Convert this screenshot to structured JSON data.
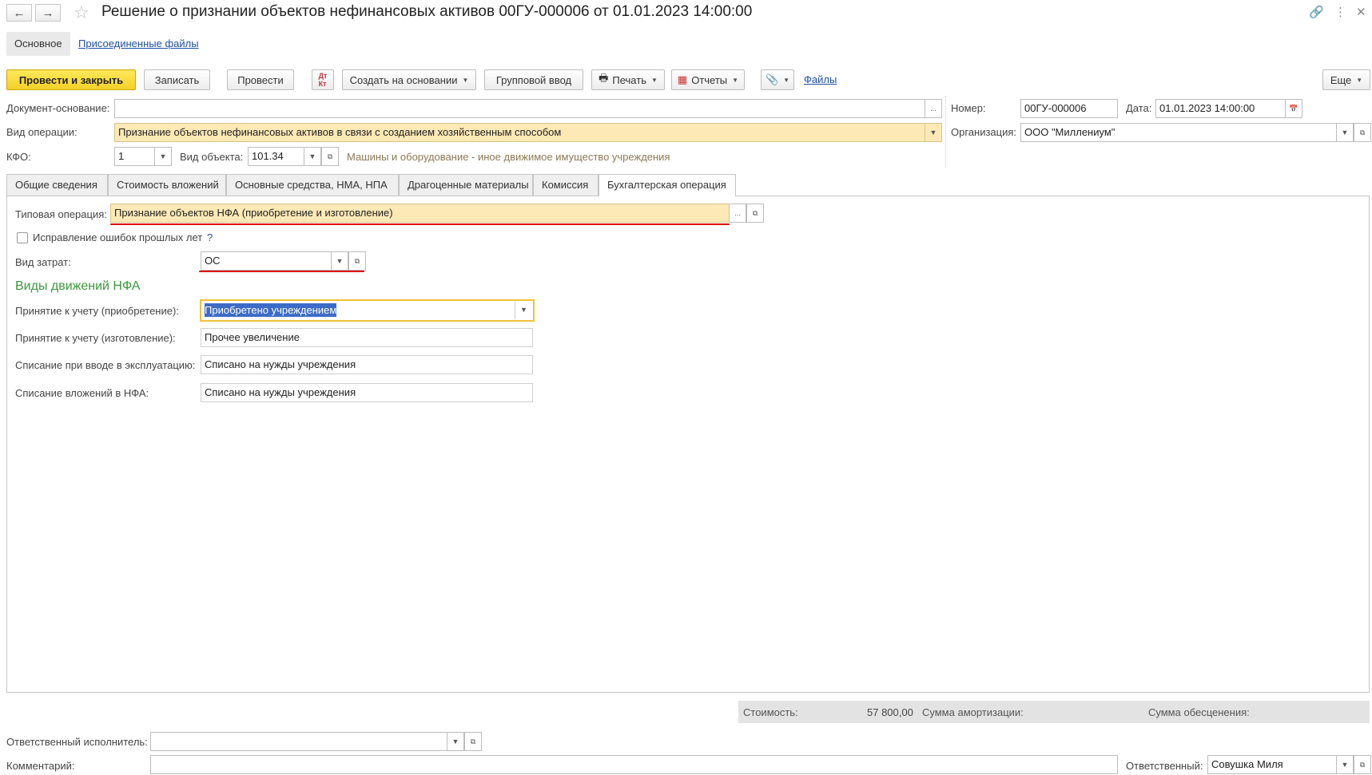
{
  "header": {
    "title": "Решение о признании объектов нефинансовых активов 00ГУ-000006 от 01.01.2023 14:00:00"
  },
  "sections": {
    "main": "Основное",
    "files": "Присоединенные файлы"
  },
  "toolbar": {
    "post_close": "Провести и закрыть",
    "save": "Записать",
    "post": "Провести",
    "create_based": "Создать на основании",
    "group_input": "Групповой ввод",
    "print": "Печать",
    "reports": "Отчеты",
    "files": "Файлы",
    "more": "Еще"
  },
  "form": {
    "base_doc_label": "Документ-основание:",
    "base_doc_value": "",
    "op_type_label": "Вид операции:",
    "op_type_value": "Признание объектов нефинансовых активов в связи с созданием хозяйственным способом",
    "kfo_label": "КФО:",
    "kfo_value": "1",
    "object_type_label": "Вид объекта:",
    "object_type_value": "101.34",
    "object_type_desc": "Машины и оборудование - иное движимое имущество учреждения",
    "number_label": "Номер:",
    "number_value": "00ГУ-000006",
    "date_label": "Дата:",
    "date_value": "01.01.2023 14:00:00",
    "org_label": "Организация:",
    "org_value": "ООО \"Миллениум\""
  },
  "tabs": [
    {
      "label": "Общие сведения"
    },
    {
      "label": "Стоимость вложений"
    },
    {
      "label": "Основные средства, НМА, НПА"
    },
    {
      "label": "Драгоценные материалы"
    },
    {
      "label": "Комиссия"
    },
    {
      "label": "Бухгалтерская операция"
    }
  ],
  "accounting": {
    "typical_op_label": "Типовая операция:",
    "typical_op_value": "Признание объектов НФА (приобретение и изготовление)",
    "error_fix_label": "Исправление ошибок прошлых лет",
    "help": "?",
    "cost_type_label": "Вид затрат:",
    "cost_type_value": "ОС",
    "movements_title": "Виды движений НФА",
    "rows": [
      {
        "label": "Принятие к учету (приобретение):",
        "value": "Приобретено учреждением"
      },
      {
        "label": "Принятие к учету (изготовление):",
        "value": "Прочее увеличение"
      },
      {
        "label": "Списание при вводе в эксплуатацию:",
        "value": "Списано на нужды учреждения"
      },
      {
        "label": "Списание вложений в НФА:",
        "value": "Списано на нужды учреждения"
      }
    ]
  },
  "summary": {
    "cost_label": "Стоимость:",
    "cost_value": "57 800,00",
    "amort_label": "Сумма амортизации:",
    "impair_label": "Сумма обесценения:"
  },
  "footer": {
    "executor_label": "Ответственный исполнитель:",
    "executor_value": "",
    "comment_label": "Комментарий:",
    "comment_value": "",
    "responsible_label": "Ответственный:",
    "responsible_value": "Совушка Миля"
  },
  "colors": {
    "accent_yellow": "#f4d128",
    "field_yellow": "#fde9b6",
    "link_blue": "#1f4fa8",
    "highlight_red": "#e00000",
    "section_green": "#3a9a3a"
  }
}
